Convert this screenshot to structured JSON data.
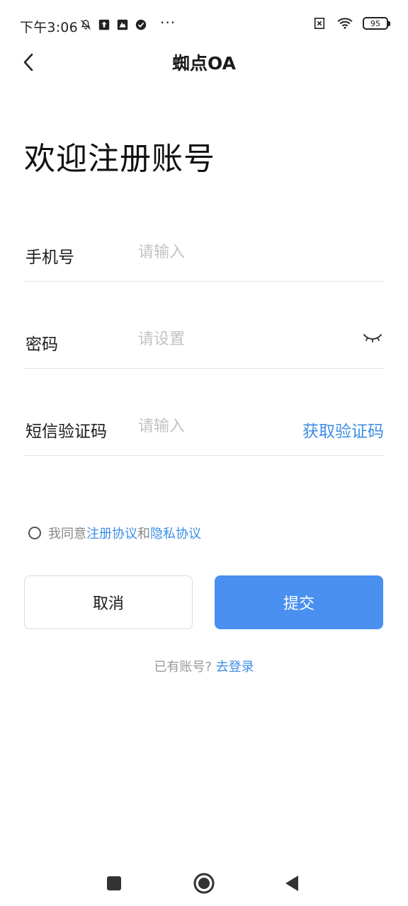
{
  "status_bar": {
    "time": "下午3:06",
    "more": "···",
    "battery": "95",
    "icons_left": [
      "mute-icon",
      "upload-icon",
      "app-icon",
      "check-circle-icon"
    ],
    "icons_right": [
      "no-sim-icon",
      "wifi-icon"
    ]
  },
  "header": {
    "title": "蜘点OA",
    "back_icon": "chevron-left-icon"
  },
  "welcome": "欢迎注册账号",
  "form": {
    "phone": {
      "label": "手机号",
      "placeholder": "请输入",
      "value": ""
    },
    "password": {
      "label": "密码",
      "placeholder": "请设置",
      "value": "",
      "toggle_icon": "eye-closed-icon"
    },
    "sms": {
      "label": "短信验证码",
      "placeholder": "请输入",
      "value": "",
      "get_code": "获取验证码"
    }
  },
  "agreement": {
    "prefix": "我同意",
    "terms": "注册协议",
    "and": "和",
    "privacy": "隐私协议",
    "checked": false
  },
  "buttons": {
    "cancel": "取消",
    "submit": "提交"
  },
  "login_hint": {
    "text": "已有账号?",
    "link": "去登录"
  },
  "colors": {
    "accent": "#3d8ee6",
    "submit_bg": "#4a90f0",
    "divider": "#e6e6e6"
  },
  "nav_bar": [
    "square-icon",
    "home-circle-icon",
    "back-triangle-icon"
  ]
}
